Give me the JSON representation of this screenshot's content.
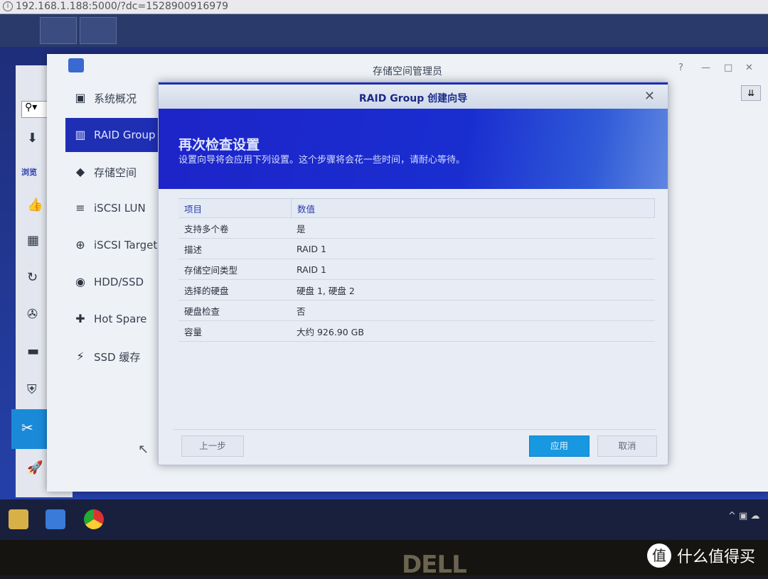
{
  "browser": {
    "url": "192.168.1.188:5000/?dc=1528900916979"
  },
  "window": {
    "title": "存储空间管理员",
    "controls": [
      "?",
      "—",
      "□",
      "✕"
    ]
  },
  "sidebar": {
    "items": [
      {
        "label": "系统概况",
        "icon": "overview-icon",
        "glyph": "▣"
      },
      {
        "label": "RAID Group",
        "icon": "raid-icon",
        "glyph": "▥",
        "selected": true
      },
      {
        "label": "存储空间",
        "icon": "cubes-icon",
        "glyph": "◆"
      },
      {
        "label": "iSCSI LUN",
        "icon": "database-icon",
        "glyph": "≡"
      },
      {
        "label": "iSCSI Target",
        "icon": "globe-icon",
        "glyph": "⊕"
      },
      {
        "label": "HDD/SSD",
        "icon": "disk-icon",
        "glyph": "◉"
      },
      {
        "label": "Hot Spare",
        "icon": "plus-box-icon",
        "glyph": "✚"
      },
      {
        "label": "SSD 缓存",
        "icon": "ssd-cache-icon",
        "glyph": "⚡"
      }
    ]
  },
  "bg_app": {
    "section_label": "浏览",
    "icons": [
      "search-icon",
      "download-icon",
      "thumbs-up-icon",
      "grid-icon",
      "backup-icon",
      "film-icon",
      "briefcase-icon",
      "shield-icon",
      "tools-icon",
      "rocket-icon"
    ]
  },
  "dialog": {
    "title": "RAID Group 创建向导",
    "heading": "再次检查设置",
    "subtitle": "设置向导将会应用下列设置。这个步骤将会花一些时间，请耐心等待。",
    "columns": [
      "项目",
      "数值"
    ],
    "rows": [
      [
        "支持多个卷",
        "是"
      ],
      [
        "描述",
        "RAID 1"
      ],
      [
        "存储空间类型",
        "RAID 1"
      ],
      [
        "选择的硬盘",
        "硬盘 1, 硬盘 2"
      ],
      [
        "硬盘检查",
        "否"
      ],
      [
        "容量",
        "大约 926.90 GB"
      ]
    ],
    "buttons": {
      "back": "上一步",
      "apply": "应用",
      "cancel": "取消"
    }
  },
  "colors": {
    "accent": "#1e2fb4",
    "apply": "#1798e0"
  },
  "watermark": {
    "text": "什么值得买",
    "logo": "值"
  },
  "monitor_brand": "DELL"
}
